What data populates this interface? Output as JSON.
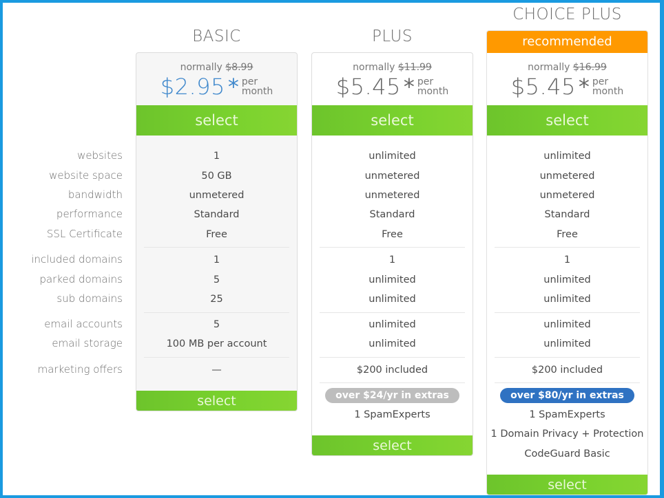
{
  "row_labels": [
    "websites",
    "website space",
    "bandwidth",
    "performance",
    "SSL Certificate",
    "included domains",
    "parked domains",
    "sub domains",
    "email accounts",
    "email storage",
    "marketing offers"
  ],
  "colors": {
    "frame": "#1a9ae0",
    "select_green": "#7ad22e",
    "recommended_orange": "#ff9900",
    "basic_price_blue": "#3f88cc",
    "extras_pill_gray": "#bdbdbd",
    "extras_pill_blue": "#2f72c2"
  },
  "plans": [
    {
      "name": "BASIC",
      "badge": null,
      "normally_label": "normally",
      "normal_price": "$8.99",
      "price": "$2.95",
      "asterisk": "*",
      "per": "per",
      "month": "month",
      "select_label": "select",
      "features": [
        "1",
        "50 GB",
        "unmetered",
        "Standard",
        "Free",
        "1",
        "5",
        "25",
        "5",
        "100 MB per account",
        "—"
      ],
      "extras_label": null,
      "extras": [],
      "bottom_select_label": "select"
    },
    {
      "name": "PLUS",
      "badge": null,
      "normally_label": "normally",
      "normal_price": "$11.99",
      "price": "$5.45",
      "asterisk": "*",
      "per": "per",
      "month": "month",
      "select_label": "select",
      "features": [
        "unlimited",
        "unmetered",
        "unmetered",
        "Standard",
        "Free",
        "1",
        "unlimited",
        "unlimited",
        "unlimited",
        "unlimited",
        "$200 included"
      ],
      "extras_label": "over $24/yr in extras",
      "extras": [
        "1 SpamExperts"
      ],
      "bottom_select_label": "select"
    },
    {
      "name": "CHOICE PLUS",
      "badge": "recommended",
      "normally_label": "normally",
      "normal_price": "$16.99",
      "price": "$5.45",
      "asterisk": "*",
      "per": "per",
      "month": "month",
      "select_label": "select",
      "features": [
        "unlimited",
        "unmetered",
        "unmetered",
        "Standard",
        "Free",
        "1",
        "unlimited",
        "unlimited",
        "unlimited",
        "unlimited",
        "$200 included"
      ],
      "extras_label": "over $80/yr in extras",
      "extras": [
        "1 SpamExperts",
        "1 Domain Privacy + Protection",
        "CodeGuard Basic"
      ],
      "bottom_select_label": "select"
    }
  ]
}
